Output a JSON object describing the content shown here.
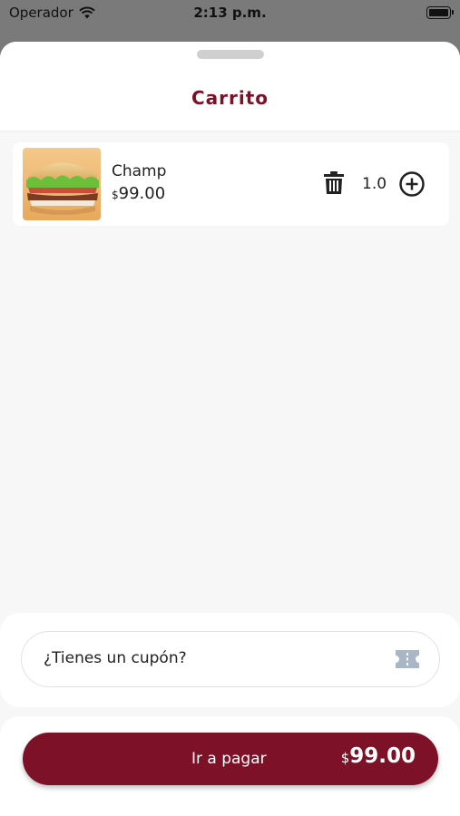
{
  "status_bar": {
    "carrier": "Operador",
    "time": "2:13 p.m."
  },
  "sheet": {
    "title": "Carrito"
  },
  "cart": {
    "items": [
      {
        "name": "Champ",
        "currency": "$",
        "price": "99.00",
        "quantity": "1.0"
      }
    ]
  },
  "coupon": {
    "placeholder": "¿Tienes un cupón?"
  },
  "checkout": {
    "label": "Ir a pagar",
    "currency": "$",
    "total": "99.00"
  },
  "colors": {
    "brand": "#7d1127",
    "coupon_icon": "#a9b6c6"
  },
  "icons": {
    "wifi": "wifi-icon",
    "battery": "battery-icon",
    "delete": "trash-icon",
    "add": "plus-circle-icon",
    "coupon": "ticket-icon"
  }
}
